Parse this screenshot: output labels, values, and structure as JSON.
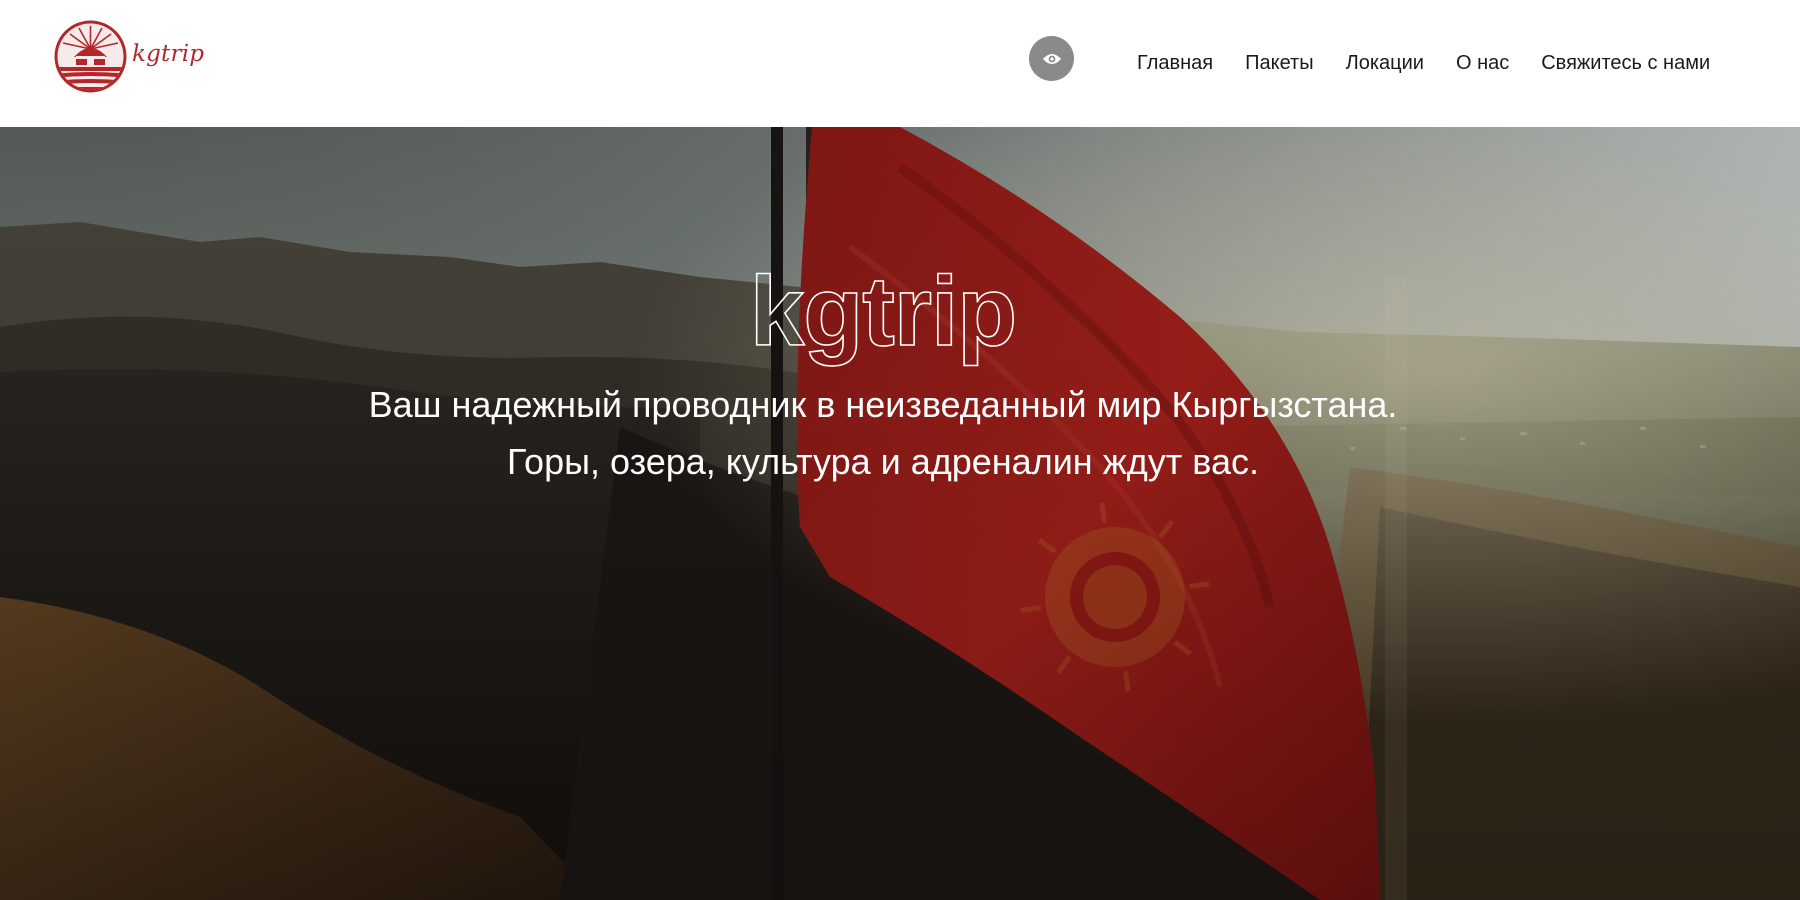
{
  "header": {
    "logo": {
      "icon": "yurt-emblem-icon",
      "text": "kgtrip",
      "color": "#b3262a"
    },
    "accessibility_icon": "eye-icon",
    "nav": [
      {
        "label": "Главная"
      },
      {
        "label": "Пакеты"
      },
      {
        "label": "Локации"
      },
      {
        "label": "О нас"
      },
      {
        "label": "Свяжитесь с нами"
      }
    ]
  },
  "hero": {
    "title": "kgtrip",
    "line1": "Ваш надежный проводник в неизведанный мир Кыргызстана.",
    "line2": "Горы, озера, культура и адреналин ждут вас.",
    "background": "kyrgyz-flag-over-mountains-photo"
  }
}
